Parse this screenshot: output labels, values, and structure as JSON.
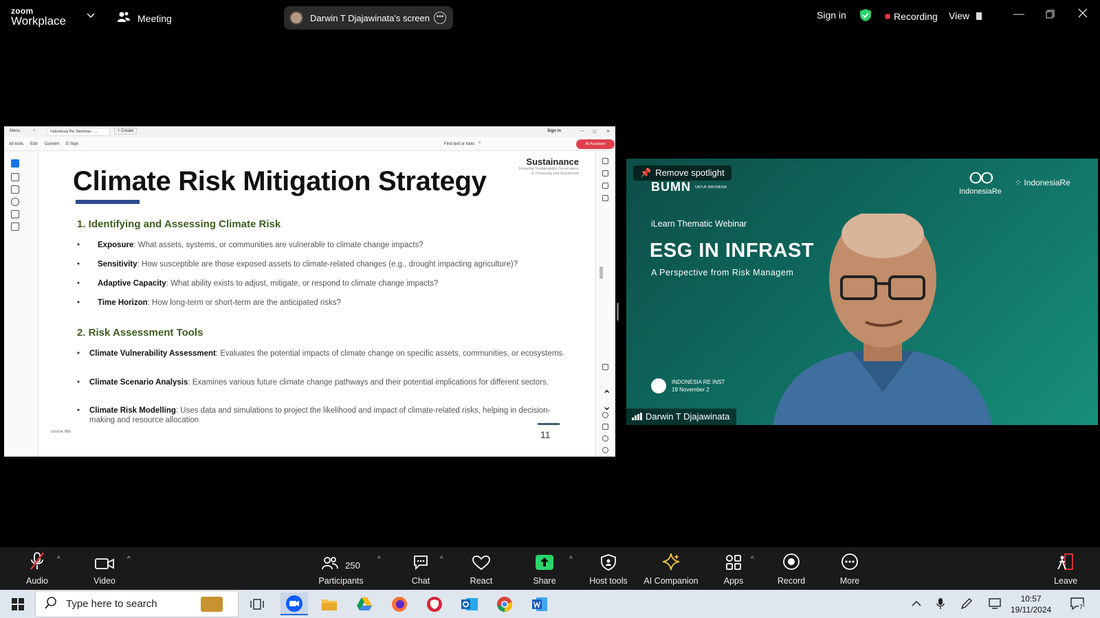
{
  "topbar": {
    "logo_small": "zoom",
    "logo_big": "Workplace",
    "meeting_label": "Meeting",
    "share_label": "Darwin T Djajawinata's screen",
    "sign_in": "Sign in",
    "recording": "Recording",
    "view": "View"
  },
  "pdf": {
    "menu": "Menu",
    "tab_title": "Indonesia Re Seminar - ...",
    "create": "Create",
    "sign_in": "Sign in",
    "tools": [
      "All tools",
      "Edit",
      "Convert",
      "E-Sign"
    ],
    "find": "Find text or tools",
    "ai_assistant": "AI Assistant"
  },
  "slide": {
    "title": "Climate Risk Mitigation Strategy",
    "brand": "Sustainance",
    "brand_sub1": "Ensuring Sustainability Governance",
    "brand_sub2": "in Financing and Investment",
    "section1": "1. Identifying and Assessing Climate Risk",
    "s1_items": [
      {
        "term": "Exposure",
        "desc": ": What assets, systems, or communities are vulnerable to climate change impacts?"
      },
      {
        "term": "Sensitivity",
        "desc": ": How susceptible are those exposed assets to climate-related changes (e.g., drought impacting agriculture)?"
      },
      {
        "term": "Adaptive Capacity",
        "desc": ": What ability exists to adjust, mitigate, or respond to climate change impacts?"
      },
      {
        "term": "Time Horizon",
        "desc": ": How long-term or short-term are the anticipated risks?"
      }
    ],
    "section2": "2. Risk Assessment Tools",
    "s2_items": [
      {
        "term": "Climate Vulnerability Assessment",
        "desc": ": Evaluates the potential impacts of climate change on specific assets, communities, or ecosystems."
      },
      {
        "term": "Climate Scenario Analysis",
        "desc": ": Examines various future climate change pathways and their potential implications for different sectors."
      },
      {
        "term": "Climate Risk Modelling",
        "desc": ": Uses data and simulations to project the likelihood and impact of climate-related risks, helping in decision-making and resource allocation"
      }
    ],
    "course_title": "course title",
    "page_number": "11"
  },
  "video": {
    "remove_spotlight": "Remove spotlight",
    "bumn": "BUMN",
    "bumn_sub": "UNTUK INDONESIA",
    "ire": "IndonesiaRe",
    "ire_inst": "IndonesiaRe",
    "ilearn": "iLearn Thematic Webinar",
    "esg": "ESG IN INFRAST",
    "perspective": "A Perspective from Risk Managem",
    "footer1": "INDONESIA RE INST",
    "footer2": "19 November 2",
    "name": "Darwin T Djajawinata"
  },
  "toolbar": {
    "audio": "Audio",
    "video": "Video",
    "participants": "Participants",
    "participants_count": "250",
    "chat": "Chat",
    "react": "React",
    "share": "Share",
    "host_tools": "Host tools",
    "ai_companion": "AI Companion",
    "apps": "Apps",
    "record": "Record",
    "more": "More",
    "leave": "Leave"
  },
  "taskbar": {
    "search_placeholder": "Type here to search",
    "time": "10:57",
    "date": "19/11/2024",
    "notifications": "7"
  },
  "colors": {
    "accent_green": "#2bd26b",
    "recording_red": "#e8323c",
    "slide_heading_green": "#3e5d1f",
    "video_teal": "#0f6a5f"
  }
}
